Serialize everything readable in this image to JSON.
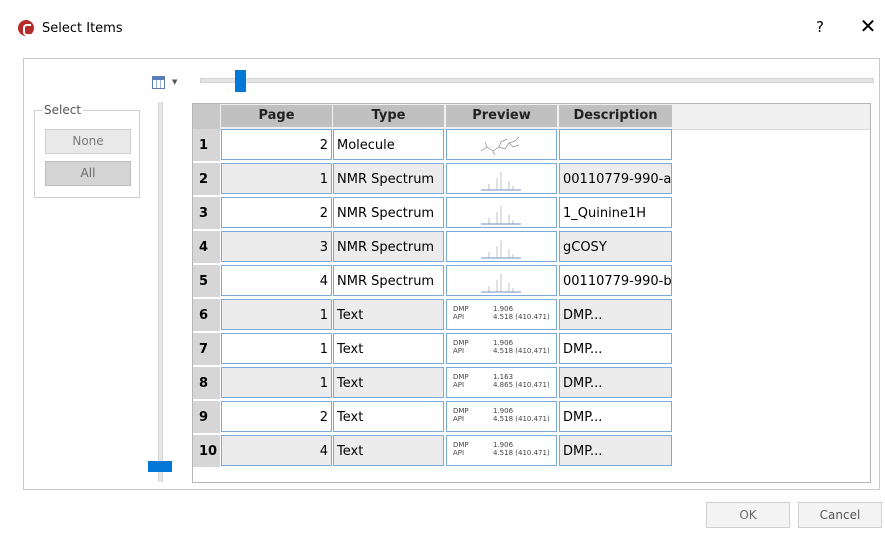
{
  "window": {
    "title": "Select Items",
    "help_label": "?",
    "close_label": "✕"
  },
  "toolbar": {
    "columns_icon": "column-chooser-icon"
  },
  "zoom_slider": {
    "value": 0.05
  },
  "row_slider": {
    "value": 0.0
  },
  "select_group": {
    "legend": "Select",
    "none_label": "None",
    "all_label": "All"
  },
  "grid": {
    "columns": [
      "Page",
      "Type",
      "Preview",
      "Description"
    ],
    "rows": [
      {
        "num": "1",
        "page": "2",
        "type": "Molecule",
        "preview": "molecule",
        "description": ""
      },
      {
        "num": "2",
        "page": "1",
        "type": "NMR Spectrum",
        "preview": "nmr",
        "description": "00110779-990-a..."
      },
      {
        "num": "3",
        "page": "2",
        "type": "NMR Spectrum",
        "preview": "nmr",
        "description": "1_Quinine1H"
      },
      {
        "num": "4",
        "page": "3",
        "type": "NMR Spectrum",
        "preview": "nmr",
        "description": "gCOSY"
      },
      {
        "num": "5",
        "page": "4",
        "type": "NMR Spectrum",
        "preview": "nmr",
        "description": "00110779-990-b..."
      },
      {
        "num": "6",
        "page": "1",
        "type": "Text",
        "preview": "text",
        "preview_left": "DMP\nAPI",
        "preview_right": "1.906\n4.518 (410.471)",
        "description": "DMP..."
      },
      {
        "num": "7",
        "page": "1",
        "type": "Text",
        "preview": "text",
        "preview_left": "DMP\nAPI",
        "preview_right": "1.906\n4.518 (410.471)",
        "description": "DMP..."
      },
      {
        "num": "8",
        "page": "1",
        "type": "Text",
        "preview": "text",
        "preview_left": "DMP\nAPI",
        "preview_right": "1.163\n4.865 (410.471)",
        "description": "DMP..."
      },
      {
        "num": "9",
        "page": "2",
        "type": "Text",
        "preview": "text",
        "preview_left": "DMP\nAPI",
        "preview_right": "1.906\n4.518 (410.471)",
        "description": "DMP..."
      },
      {
        "num": "10",
        "page": "4",
        "type": "Text",
        "preview": "text",
        "preview_left": "DMP\nAPI",
        "preview_right": "1.906\n4.518 (410.471)",
        "description": "DMP..."
      }
    ]
  },
  "footer": {
    "ok_label": "OK",
    "cancel_label": "Cancel"
  },
  "colors": {
    "accent": "#0078d7",
    "cell_border": "#7aa9dc",
    "header_bg": "#c0c0c0"
  }
}
